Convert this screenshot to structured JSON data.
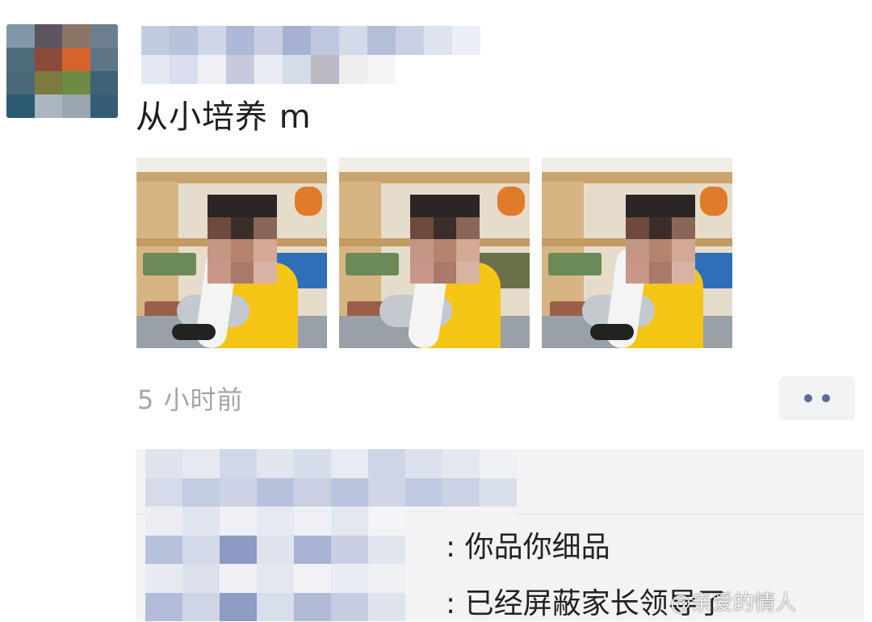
{
  "post": {
    "text": "从小培养 m",
    "time": "5 小时前"
  },
  "images": [
    {
      "icon": "classroom-photo-1"
    },
    {
      "icon": "classroom-photo-2"
    },
    {
      "icon": "classroom-photo-3"
    }
  ],
  "comments": [
    {
      "text": ": 你品你细品"
    },
    {
      "text": ": 已经屏蔽家长领导了"
    }
  ],
  "watermark": "@亲爱的情人",
  "colors": {
    "link_blue": "#576b95",
    "comment_bg": "#f3f3f5",
    "time_gray": "#a6a6a6"
  }
}
